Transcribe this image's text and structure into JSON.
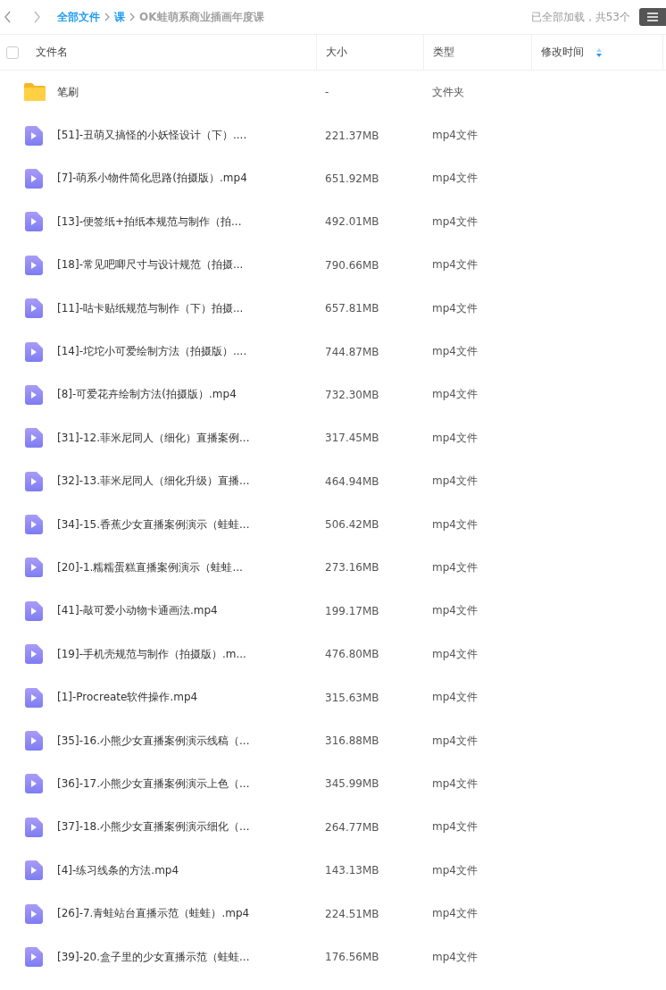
{
  "breadcrumb": [
    {
      "label": "全部文件",
      "kind": "link"
    },
    {
      "label": "课",
      "kind": "link"
    },
    {
      "label": "OK蛙萌系商业插画年度课",
      "kind": "current"
    }
  ],
  "status": "已全部加载，共53个",
  "table": {
    "select_all": {
      "checked": false
    },
    "columns": [
      {
        "label": "文件名"
      },
      {
        "label": "大小"
      },
      {
        "label": "类型"
      },
      {
        "label": "修改时间",
        "sorted": true
      }
    ],
    "rows": [
      {
        "kind": "folder",
        "name": "笔刷",
        "size": "-",
        "type": "文件夹"
      },
      {
        "kind": "video",
        "name": "[51]-丑萌又搞怪的小妖怪设计（下）....",
        "size": "221.37MB",
        "type": "mp4文件"
      },
      {
        "kind": "video",
        "name": "[7]-萌系小物件简化思路(拍摄版）.mp4",
        "size": "651.92MB",
        "type": "mp4文件"
      },
      {
        "kind": "video",
        "name": "[13]-便签纸+拍纸本规范与制作（拍...",
        "size": "492.01MB",
        "type": "mp4文件"
      },
      {
        "kind": "video",
        "name": "[18]-常见吧唧尺寸与设计规范（拍摄...",
        "size": "790.66MB",
        "type": "mp4文件"
      },
      {
        "kind": "video",
        "name": "[11]-咕卡贴纸规范与制作（下）拍摄...",
        "size": "657.81MB",
        "type": "mp4文件"
      },
      {
        "kind": "video",
        "name": "[14]-坨坨小可爱绘制方法（拍摄版）....",
        "size": "744.87MB",
        "type": "mp4文件"
      },
      {
        "kind": "video",
        "name": "[8]-可爱花卉绘制方法(拍摄版）.mp4",
        "size": "732.30MB",
        "type": "mp4文件"
      },
      {
        "kind": "video",
        "name": "[31]-12.菲米尼同人（细化）直播案例...",
        "size": "317.45MB",
        "type": "mp4文件"
      },
      {
        "kind": "video",
        "name": "[32]-13.菲米尼同人（细化升级）直播...",
        "size": "464.94MB",
        "type": "mp4文件"
      },
      {
        "kind": "video",
        "name": "[34]-15.香蕉少女直播案例演示（蛙蛙...",
        "size": "506.42MB",
        "type": "mp4文件"
      },
      {
        "kind": "video",
        "name": "[20]-1.糯糯蛋糕直播案例演示（蛙蛙...",
        "size": "273.16MB",
        "type": "mp4文件"
      },
      {
        "kind": "video",
        "name": "[41]-敲可爱小动物卡通画法.mp4",
        "size": "199.17MB",
        "type": "mp4文件"
      },
      {
        "kind": "video",
        "name": "[19]-手机壳规范与制作（拍摄版）.m...",
        "size": "476.80MB",
        "type": "mp4文件"
      },
      {
        "kind": "video",
        "name": "[1]-Procreate软件操作.mp4",
        "size": "315.63MB",
        "type": "mp4文件"
      },
      {
        "kind": "video",
        "name": "[35]-16.小熊少女直播案例演示线稿（...",
        "size": "316.88MB",
        "type": "mp4文件"
      },
      {
        "kind": "video",
        "name": "[36]-17.小熊少女直播案例演示上色（...",
        "size": "345.99MB",
        "type": "mp4文件"
      },
      {
        "kind": "video",
        "name": "[37]-18.小熊少女直播案例演示细化（...",
        "size": "264.77MB",
        "type": "mp4文件"
      },
      {
        "kind": "video",
        "name": "[4]-练习线条的方法.mp4",
        "size": "143.13MB",
        "type": "mp4文件"
      },
      {
        "kind": "video",
        "name": "[26]-7.青蛙站台直播示范（蛙蛙）.mp4",
        "size": "224.51MB",
        "type": "mp4文件"
      },
      {
        "kind": "video",
        "name": "[39]-20.盒子里的少女直播示范（蛙蛙...",
        "size": "176.56MB",
        "type": "mp4文件"
      }
    ]
  }
}
